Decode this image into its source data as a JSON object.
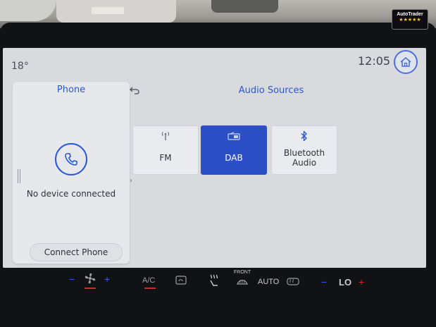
{
  "status_bar": {
    "temperature": "18°",
    "time": "12:05"
  },
  "phone_panel": {
    "title": "Phone",
    "status": "No device connected",
    "connect_label": "Connect Phone"
  },
  "audio_panel": {
    "title": "Audio Sources",
    "sources": [
      {
        "label": "FM",
        "icon": "radio-antenna-icon",
        "active": false
      },
      {
        "label": "DAB",
        "icon": "dab-radio-icon",
        "active": true
      },
      {
        "label_line1": "Bluetooth",
        "label_line2": "Audio",
        "icon": "bluetooth-icon",
        "active": false
      }
    ]
  },
  "climate_bar": {
    "ac_label": "A/C",
    "front_label": "FRONT",
    "auto_label": "AUTO",
    "temp_setting": "LO",
    "minus": "−",
    "plus": "+"
  },
  "badge": {
    "brand": "AutoTrader",
    "stars": "★★★★★"
  },
  "colors": {
    "accent_blue": "#2a58d8",
    "active_tile": "#2d4fc6",
    "screen_bg": "#d8dade",
    "card_bg": "#e6e8ec"
  }
}
